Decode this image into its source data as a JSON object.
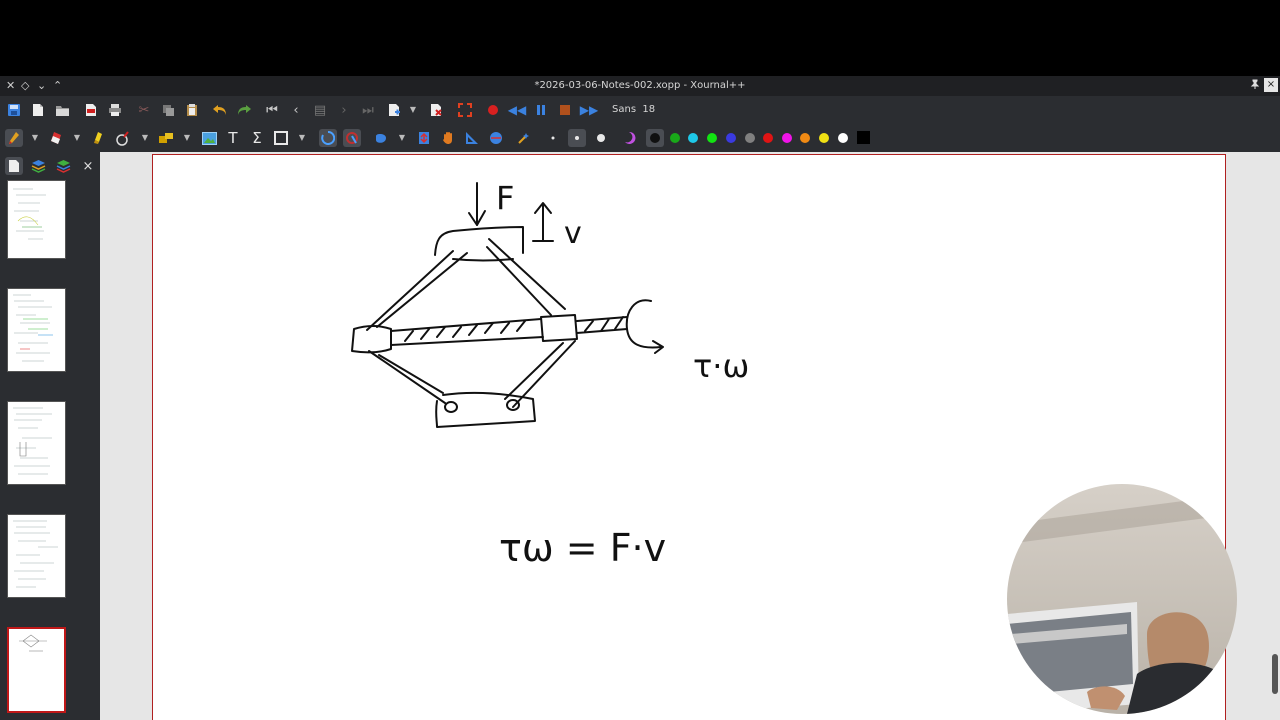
{
  "window": {
    "title": "*2026-03-06-Notes-002.xopp - Xournal++",
    "close_glyph": "×",
    "pin_glyph": "📌"
  },
  "toolbar": {
    "font_name": "Sans",
    "font_size": "18",
    "colors": [
      "#101010",
      "#19a819",
      "#1ec8e8",
      "#12e412",
      "#3a3ae0",
      "#808080",
      "#e01414",
      "#f014e8",
      "#f08a14",
      "#f0e014",
      "#ffffff",
      "#000000"
    ],
    "accent": "#3b82e0"
  },
  "sidebar": {
    "close_glyph": "×",
    "page_count": 5,
    "selected_page": 5
  },
  "drawing": {
    "label_force": "F",
    "label_velocity": "v",
    "label_torque_omega": "τ·ω",
    "equation": "τω = F·v"
  }
}
